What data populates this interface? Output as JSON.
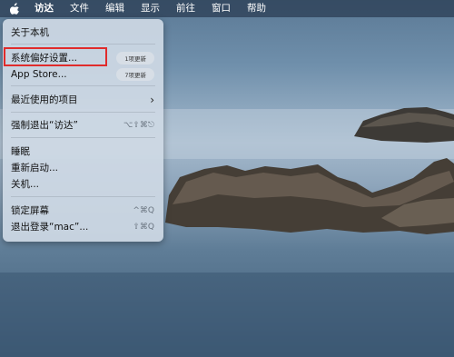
{
  "menubar": {
    "apple_icon": "apple-logo-icon",
    "items": [
      "访达",
      "文件",
      "编辑",
      "显示",
      "前往",
      "窗口",
      "帮助"
    ]
  },
  "apple_menu": {
    "about": "关于本机",
    "system_prefs": "系统偏好设置...",
    "system_prefs_badge": "1项更新",
    "app_store": "App Store...",
    "app_store_badge": "7项更新",
    "recent_items": "最近使用的项目",
    "recent_items_icon": "chevron-right-icon",
    "force_quit": "强制退出“访达”",
    "force_quit_shortcut": "⌥⇧⌘⎋",
    "sleep": "睡眠",
    "restart": "重新启动...",
    "shutdown": "关机...",
    "lock_screen": "锁定屏幕",
    "lock_screen_shortcut": "^⌘Q",
    "logout": "退出登录“mac”...",
    "logout_shortcut": "⇧⌘Q"
  },
  "colors": {
    "highlight_border": "#e02b2b"
  }
}
